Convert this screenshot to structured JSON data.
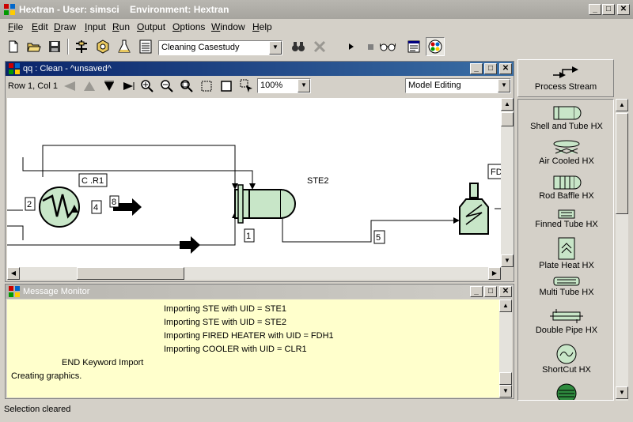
{
  "app": {
    "title": "Hextran - User: simsci    Environment: Hextran",
    "min": "_",
    "max": "□",
    "close": "✕"
  },
  "menu": [
    "File",
    "Edit",
    "Draw",
    "Input",
    "Run",
    "Output",
    "Options",
    "Window",
    "Help"
  ],
  "menu_underline": [
    "F",
    "E",
    "D",
    "I",
    "R",
    "O",
    "O",
    "W",
    "H"
  ],
  "toolbar": {
    "casestudy_value": "Cleaning Casestudy",
    "icons": [
      "new-file-icon",
      "open-folder-icon",
      "save-icon",
      "flowsheet-icon",
      "component-icon",
      "flask-icon",
      "grid-icon",
      "binoculars-icon",
      "cancel-icon",
      "run-icon",
      "stop-icon",
      "glasses-icon",
      "report-icon",
      "palette-icon"
    ]
  },
  "diagram": {
    "title": "qq : Clean - ^unsaved^",
    "cursor_pos": "Row 1, Col 1",
    "zoom": "100%",
    "mode": "Model Editing",
    "labels": {
      "clr1": "C .R1",
      "ste2": "STE2",
      "fdh": "FD",
      "stream2": "2",
      "stream4": "4",
      "stream8": "8",
      "stream1": "1",
      "stream5": "5"
    }
  },
  "messages": {
    "title": "Message Monitor",
    "lines": [
      "Importing STE with UID = STE1",
      "Importing STE with UID = STE2",
      "Importing FIRED HEATER with UID = FDH1",
      "Importing COOLER with UID = CLR1",
      "END Keyword Import",
      "Creating graphics."
    ]
  },
  "palette": {
    "header": "Process Stream",
    "items": [
      "Shell and Tube HX",
      "Air Cooled HX",
      "Rod Baffle HX",
      "Finned Tube HX",
      "Plate Heat HX",
      "Multi Tube HX",
      "Double Pipe HX",
      "ShortCut HX"
    ]
  },
  "status": "Selection cleared",
  "colors": {
    "equipment_fill": "#c8e6c8",
    "message_bg": "#ffffcc",
    "active_title": "#0a246a"
  }
}
